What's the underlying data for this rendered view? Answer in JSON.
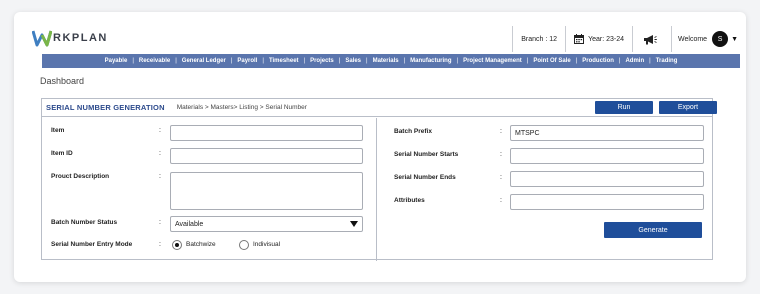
{
  "brand": {
    "logo_letter": "W",
    "logo_text": "RKPLAN"
  },
  "header": {
    "branch": "Branch : 12",
    "year": "Year: 23-24",
    "welcome": "Welcome",
    "avatar_initial": "S"
  },
  "nav": [
    "Payable",
    "Receivable",
    "General Ledger",
    "Payroll",
    "Timesheet",
    "Projects",
    "Sales",
    "Materials",
    "Manufacturing",
    "Project Management",
    "Point Of Sale",
    "Production",
    "Admin",
    "Trading"
  ],
  "page_title": "Dashboard",
  "section": {
    "title": "SERIAL NUMBER GENERATION",
    "breadcrumb": "Materials > Masters> Listing > Serial Number",
    "run_label": "Run",
    "export_label": "Export"
  },
  "left_form": {
    "item_label": "Item",
    "item_id_label": "Item ID",
    "description_label": "Prouct Description",
    "batch_status_label": "Batch Number Status",
    "batch_status_value": "Available",
    "entry_mode_label": "Serial Number Entry Mode",
    "mode_option_1": "Batchwize",
    "mode_option_2": "Indivisual",
    "colon": ":"
  },
  "right_form": {
    "batch_prefix_label": "Batch Prefix",
    "batch_prefix_value": "MTSPC",
    "serial_start_label": "Serial Number Starts",
    "serial_end_label": "Serial Number Ends",
    "attributes_label": "Attributes",
    "generate_label": "Generate"
  },
  "colors": {
    "nav_bg": "#5a75ad",
    "button_bg": "#1f4e9a",
    "title_blue": "#2c4a8c"
  }
}
